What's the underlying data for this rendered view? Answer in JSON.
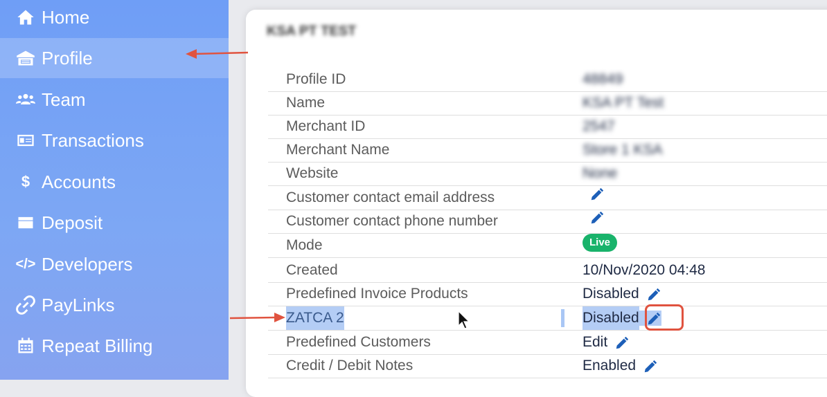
{
  "sidebar": {
    "items": [
      {
        "label": "Home",
        "icon": "home-icon"
      },
      {
        "label": "Profile",
        "icon": "profile-icon",
        "active": true
      },
      {
        "label": "Team",
        "icon": "team-icon"
      },
      {
        "label": "Transactions",
        "icon": "transactions-icon"
      },
      {
        "label": "Accounts",
        "icon": "dollar-icon"
      },
      {
        "label": "Deposit",
        "icon": "wallet-icon"
      },
      {
        "label": "Developers",
        "icon": "code-icon"
      },
      {
        "label": "PayLinks",
        "icon": "link-icon"
      },
      {
        "label": "Repeat Billing",
        "icon": "calendar-icon"
      }
    ]
  },
  "profile": {
    "title": "KSA PT TEST",
    "rows": [
      {
        "label": "Profile ID",
        "value": "48849"
      },
      {
        "label": "Name",
        "value": "KSA PT Test"
      },
      {
        "label": "Merchant ID",
        "value": "2547"
      },
      {
        "label": "Merchant Name",
        "value": "Store 1 KSA"
      },
      {
        "label": "Website",
        "value": "None"
      },
      {
        "label": "Customer contact email address",
        "value": ""
      },
      {
        "label": "Customer contact phone number",
        "value": ""
      },
      {
        "label": "Mode",
        "value": "Live"
      },
      {
        "label": "Created",
        "value": "10/Nov/2020 04:48"
      },
      {
        "label": "Predefined Invoice Products",
        "value": "Disabled"
      },
      {
        "label": "ZATCA 2",
        "value": "Disabled"
      },
      {
        "label": "Predefined Customers",
        "value": "Edit"
      },
      {
        "label": "Credit / Debit Notes",
        "value": "Enabled"
      }
    ]
  },
  "colors": {
    "sidebar_start": "#6f9ef6",
    "live_badge": "#19b36b",
    "edit_icon": "#1d5fb8",
    "annotation": "#e0533f"
  }
}
